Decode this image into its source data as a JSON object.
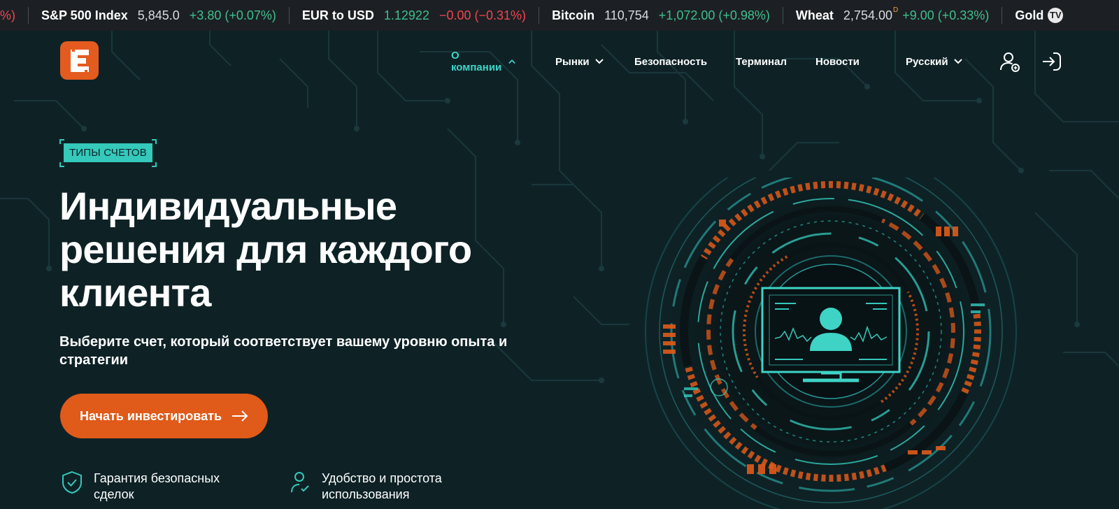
{
  "ticker": {
    "leading_fragment": "%)",
    "items": [
      {
        "name": "S&P 500 Index",
        "price": "5,845.0",
        "sup": "",
        "change": "+3.80 (+0.07%)",
        "direction": "up"
      },
      {
        "name": "EUR to USD",
        "price": "1.12922",
        "sup": "",
        "change": "−0.00 (−0.31%)",
        "direction": "down"
      },
      {
        "name": "Bitcoin",
        "price": "110,754",
        "sup": "",
        "change": "+1,072.00 (+0.98%)",
        "direction": "up"
      },
      {
        "name": "Wheat",
        "price": "2,754.00",
        "sup": "D",
        "change": "+9.00 (+0.33%)",
        "direction": "up"
      },
      {
        "name": "Gold",
        "price": "",
        "sup": "",
        "change": "",
        "direction": "up"
      }
    ],
    "trailing_badge": "TV",
    "colors": {
      "up": "#3fbf8c",
      "down": "#f0454f"
    }
  },
  "header": {
    "logo_icon": "E-logo-icon",
    "nav": [
      {
        "label": "О компании",
        "has_chevron": true,
        "chevron": "up",
        "active": true
      },
      {
        "label": "Рынки",
        "has_chevron": true,
        "chevron": "down",
        "active": false
      },
      {
        "label": "Безопасность",
        "has_chevron": false,
        "active": false
      },
      {
        "label": "Терминал",
        "has_chevron": false,
        "active": false
      },
      {
        "label": "Новости",
        "has_chevron": false,
        "active": false
      },
      {
        "label": "Русский",
        "has_chevron": true,
        "chevron": "down",
        "active": false
      }
    ],
    "actions": [
      "register-user-icon",
      "login-arrow-icon"
    ]
  },
  "hero": {
    "badge": "ТИПЫ СЧЕТОВ",
    "title_lines": [
      "Индивидуальные",
      "решения для каждого",
      "клиента"
    ],
    "subtitle": "Выберите счет, который соответствует вашему уровню опыта и стратегии",
    "cta": "Начать инвестировать"
  },
  "features": [
    {
      "icon": "shield-check-icon",
      "label": "Гарантия безопасных сделок"
    },
    {
      "icon": "user-check-icon",
      "label": "Удобство и простота использования"
    }
  ],
  "colors": {
    "background": "#0e2226",
    "accent_teal": "#34c9bb",
    "accent_orange": "#e05a19",
    "ticker_bg": "#1c2024"
  }
}
